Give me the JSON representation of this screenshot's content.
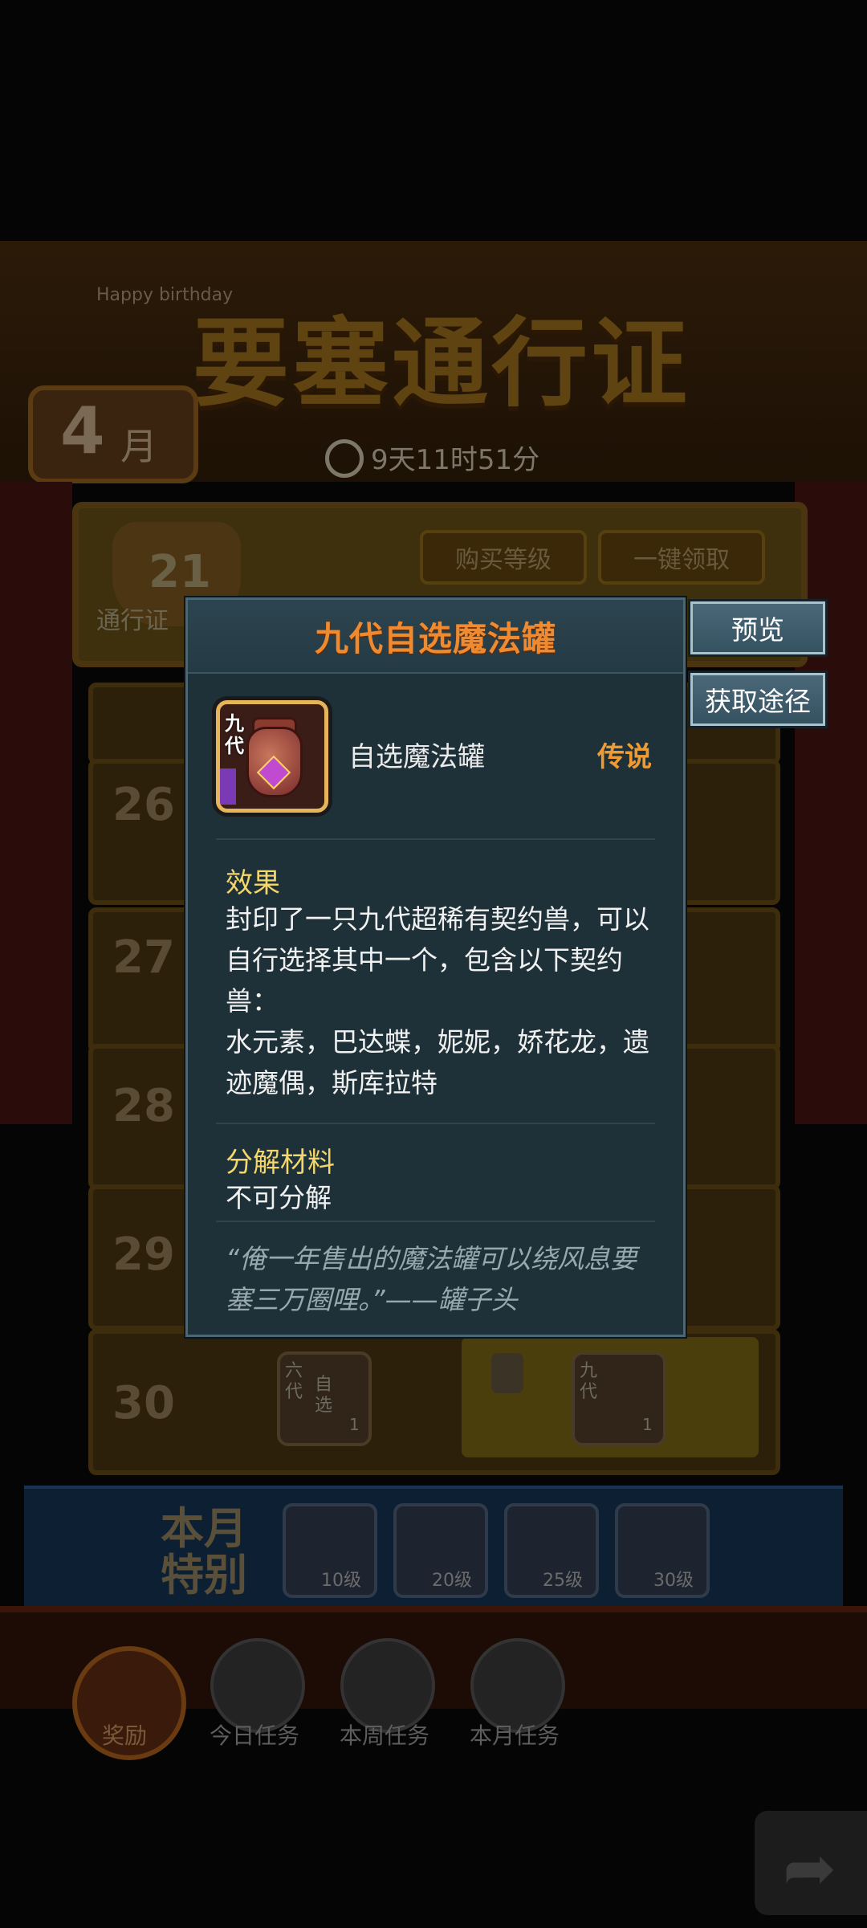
{
  "background": {
    "banner_title": "要塞通行证",
    "banner_badge_text": "Happy birthday",
    "month_number": "4",
    "month_unit": "月",
    "timer": "9天11时51分",
    "pass_level": "21",
    "pass_label": "通行证",
    "buy_level_button": "购买等级",
    "claim_all_button": "一键领取",
    "rows": [
      {
        "level": "26"
      },
      {
        "level": "27"
      },
      {
        "level": "28"
      },
      {
        "level": "29"
      },
      {
        "level": "30"
      }
    ],
    "row30_free_item_label": "自选",
    "row30_free_item_tag": "六代",
    "row30_free_item_count": "1",
    "row30_premium_item_tag": "九代",
    "row30_premium_item_count": "1",
    "monthly_special_label": "本月特别",
    "monthly_special_items": [
      {
        "caption": "10级"
      },
      {
        "caption": "20级"
      },
      {
        "caption": "25级"
      },
      {
        "caption": "30级"
      }
    ],
    "tabs": [
      {
        "label": "奖励"
      },
      {
        "label": "今日任务"
      },
      {
        "label": "本周任务"
      },
      {
        "label": "本月任务"
      }
    ]
  },
  "popup": {
    "title": "九代自选魔法罐",
    "item_icon_tag": "九代",
    "item_name": "自选魔法罐",
    "rarity": "传说",
    "effect_heading": "效果",
    "effect_text_1": "封印了一只九代超稀有契约兽，可以自行选择其中一个，包含以下契约兽：",
    "effect_text_2": "水元素，巴达蝶，妮妮，娇花龙，遗迹魔偶，斯库拉特",
    "decompose_heading": "分解材料",
    "decompose_text": "不可分解",
    "quote": "“俺一年售出的魔法罐可以绕风息要塞三万圈哩。”——罐子头"
  },
  "side_buttons": {
    "preview": "预览",
    "acquire": "获取途径"
  }
}
